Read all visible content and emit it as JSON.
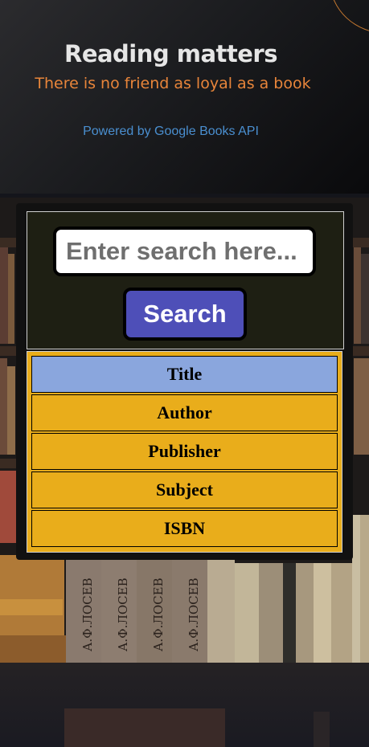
{
  "header": {
    "title": "Reading matters",
    "subtitle": "There is no friend as loyal as a book",
    "powered_by": "Powered by Google Books API"
  },
  "search": {
    "placeholder": "Enter search here...",
    "button_label": "Search"
  },
  "search_options": [
    {
      "label": "Title",
      "selected": true
    },
    {
      "label": "Author",
      "selected": false
    },
    {
      "label": "Publisher",
      "selected": false
    },
    {
      "label": "Subject",
      "selected": false
    },
    {
      "label": "ISBN",
      "selected": false
    }
  ],
  "background": {
    "book_spines": [
      "А.Ф.ЛОСЕВ",
      "А.Ф.ЛОСЕВ",
      "А.Ф.ЛОСЕВ",
      "А.Ф.ЛОСЕВ"
    ]
  },
  "colors": {
    "subtitle": "#e8853a",
    "link": "#4a8fd0",
    "button": "#4e4fb8",
    "option_bg": "#e9ad1b",
    "option_selected": "#8aa6dd"
  }
}
